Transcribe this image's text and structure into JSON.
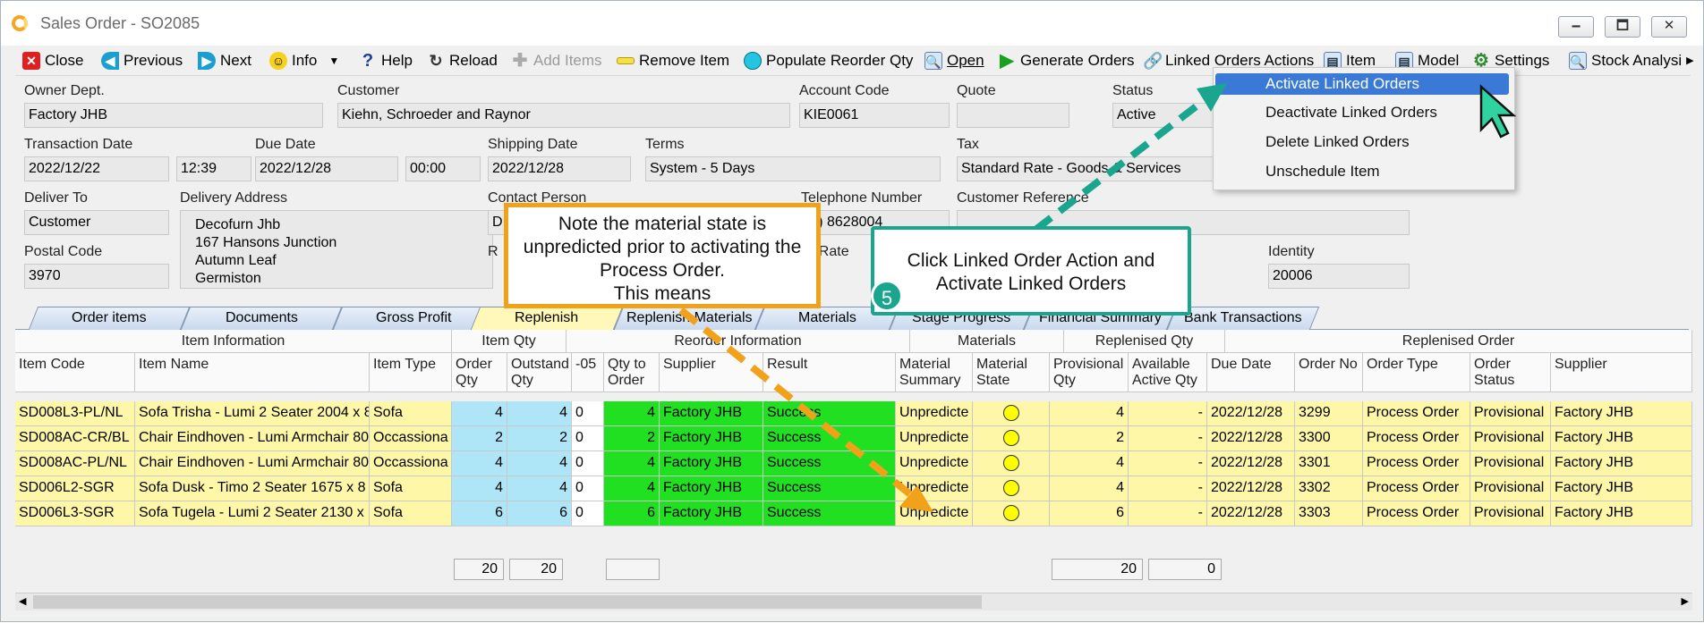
{
  "window": {
    "title": "Sales Order - SO2085",
    "min": "🗕",
    "max": "🗖",
    "close": "✕"
  },
  "toolbar": {
    "close": "Close",
    "previous": "Previous",
    "next": "Next",
    "info": "Info",
    "help": "Help",
    "reload": "Reload",
    "add_items": "Add Items",
    "remove_item": "Remove Item",
    "populate": "Populate Reorder Qty",
    "open": "Open",
    "generate": "Generate Orders",
    "linked": "Linked Orders Actions",
    "item": "Item",
    "model": "Model",
    "settings": "Settings",
    "stock": "Stock Analysi"
  },
  "form": {
    "owner_dept_label": "Owner Dept.",
    "owner_dept": "Factory JHB",
    "customer_label": "Customer",
    "customer": "Kiehn, Schroeder and Raynor",
    "account_code_label": "Account Code",
    "account_code": "KIE0061",
    "quote_label": "Quote",
    "quote": "",
    "status_label": "Status",
    "status": "Active",
    "transaction_date_label": "Transaction Date",
    "transaction_date": "2022/12/22",
    "transaction_time": "12:39",
    "due_date_label": "Due Date",
    "due_date": "2022/12/28",
    "due_time": "00:00",
    "shipping_date_label": "Shipping Date",
    "shipping_date": "2022/12/28",
    "terms_label": "Terms",
    "terms": "System - 5 Days",
    "tax_label": "Tax",
    "tax": "Standard Rate - Goods & Services",
    "deliver_to_label": "Deliver To",
    "deliver_to": "Customer",
    "delivery_address_label": "Delivery Address",
    "address_lines": [
      "Decofurn Jhb",
      "167 Hansons Junction",
      "Autumn Leaf",
      "Germiston"
    ],
    "contact_person_label": "Contact Person",
    "contact_person": "D",
    "telephone_label": "Telephone Number",
    "telephone": "(9) 8628004",
    "customer_ref_label": "Customer Reference",
    "postal_code_label": "Postal Code",
    "postal_code": "3970",
    "r_label": "R",
    "exch_rate_label": "h. Rate",
    "identity_label": "Identity",
    "identity": "20006"
  },
  "tabs": [
    "Order items",
    "Documents",
    "Gross Profit",
    "Replenish",
    "Replenish Materials",
    "Materials",
    "Stage Progress",
    "Financial Summary",
    "Bank Transactions"
  ],
  "grid": {
    "groups": {
      "item_info": "Item Information",
      "item_qty": "Item Qty",
      "reorder": "Reorder Information",
      "materials": "Materials",
      "replenished_qty": "Replenised Qty",
      "replenished_order": "Replenised Order"
    },
    "columns": {
      "item_code": "Item Code",
      "item_name": "Item Name",
      "item_type": "Item Type",
      "order_qty": "Order\nQty",
      "outstanding_qty": "Outstand\nQty",
      "col_05": "-05",
      "qty_to_order": "Qty to\nOrder",
      "supplier": "Supplier",
      "result": "Result",
      "material_summary": "Material\nSummary",
      "material_state": "Material\nState",
      "provisional_qty": "Provisional\nQty",
      "available_active_qty": "Available\nActive Qty",
      "due_date": "Due Date",
      "order_no": "Order No",
      "order_type": "Order Type",
      "order_status": "Order\nStatus",
      "supplier2": "Supplier"
    },
    "rows": [
      {
        "code": "SD008L3-PL/NL",
        "name": "Sofa Trisha - Lumi 2 Seater 2004 x 8",
        "type": "Sofa",
        "order_qty": "4",
        "out_qty": "4",
        "c05": "0",
        "qty_to_order": "4",
        "supplier": "Factory JHB",
        "result": "Success",
        "mat_summary": "Unpredicte",
        "prov_qty": "4",
        "avail": "-",
        "due": "2022/12/28",
        "order_no": "3299",
        "order_type": "Process Order",
        "order_status": "Provisional",
        "supplier2": "Factory JHB"
      },
      {
        "code": "SD008AC-CR/BL",
        "name": "Chair Eindhoven - Lumi Armchair 800",
        "type": "Occassiona",
        "order_qty": "2",
        "out_qty": "2",
        "c05": "0",
        "qty_to_order": "2",
        "supplier": "Factory JHB",
        "result": "Success",
        "mat_summary": "Unpredicte",
        "prov_qty": "2",
        "avail": "-",
        "due": "2022/12/28",
        "order_no": "3300",
        "order_type": "Process Order",
        "order_status": "Provisional",
        "supplier2": "Factory JHB"
      },
      {
        "code": "SD008AC-PL/NL",
        "name": "Chair Eindhoven - Lumi Armchair 800",
        "type": "Occassiona",
        "order_qty": "4",
        "out_qty": "4",
        "c05": "0",
        "qty_to_order": "4",
        "supplier": "Factory JHB",
        "result": "Success",
        "mat_summary": "Unpredicte",
        "prov_qty": "4",
        "avail": "-",
        "due": "2022/12/28",
        "order_no": "3301",
        "order_type": "Process Order",
        "order_status": "Provisional",
        "supplier2": "Factory JHB"
      },
      {
        "code": "SD006L2-SGR",
        "name": "Sofa Dusk - Timo 2 Seater 1675 x 8",
        "type": "Sofa",
        "order_qty": "4",
        "out_qty": "4",
        "c05": "0",
        "qty_to_order": "4",
        "supplier": "Factory JHB",
        "result": "Success",
        "mat_summary": "Unpredicte",
        "prov_qty": "4",
        "avail": "-",
        "due": "2022/12/28",
        "order_no": "3302",
        "order_type": "Process Order",
        "order_status": "Provisional",
        "supplier2": "Factory JHB"
      },
      {
        "code": "SD006L3-SGR",
        "name": "Sofa Tugela - Lumi 2 Seater 2130 x",
        "type": "Sofa",
        "order_qty": "6",
        "out_qty": "6",
        "c05": "0",
        "qty_to_order": "6",
        "supplier": "Factory JHB",
        "result": "Success",
        "mat_summary": "Unpredicte",
        "prov_qty": "6",
        "avail": "-",
        "due": "2022/12/28",
        "order_no": "3303",
        "order_type": "Process Order",
        "order_status": "Provisional",
        "supplier2": "Factory JHB"
      }
    ],
    "totals": {
      "order_qty": "20",
      "out_qty": "20",
      "prov_qty": "20",
      "avail": "0"
    }
  },
  "menu": [
    "Activate Linked Orders",
    "Deactivate Linked Orders",
    "Delete Linked Orders",
    "Unschedule Item"
  ],
  "callouts": {
    "note": "Note the material state is unpredicted prior to activating the Process Order.\nThis means",
    "step": "Click Linked Order Action and Activate Linked Orders",
    "step_number": "5"
  },
  "colors": {
    "accent_orange": "#f2a11a",
    "accent_teal": "#1aa68e",
    "row_yellow": "#fff7a8",
    "qty_blue": "#aee6f8",
    "success_green": "#21e021",
    "menu_highlight": "#3a7ad6"
  }
}
